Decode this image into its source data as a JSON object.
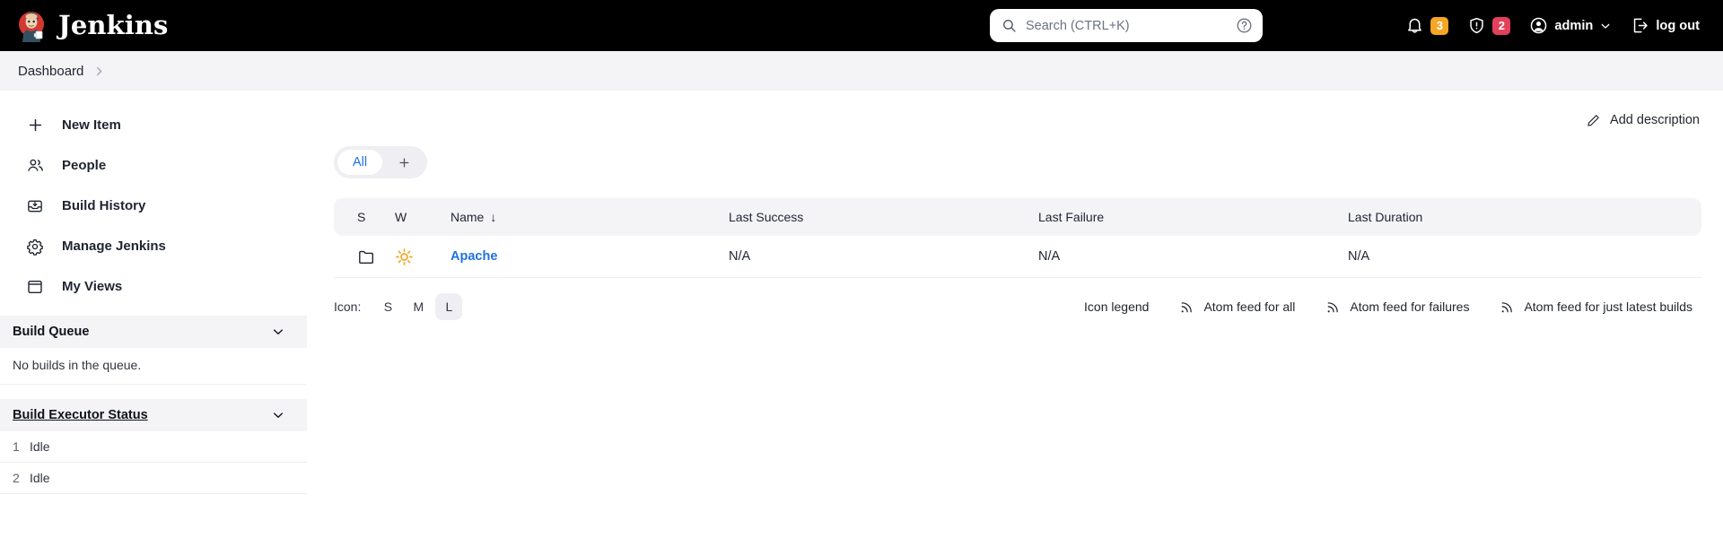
{
  "header": {
    "brand_title": "Jenkins",
    "logo_icon": "jenkins-butler-logo",
    "search": {
      "icon": "search-icon",
      "placeholder": "Search (CTRL+K)",
      "value": "",
      "help_icon": "question-circle-icon"
    },
    "notifications": {
      "icon": "bell-icon",
      "count": "3",
      "color": "#f5a623"
    },
    "security": {
      "icon": "shield-warning-icon",
      "count": "2",
      "color": "#e2405b"
    },
    "user": {
      "icon": "user-circle-icon",
      "name": "admin",
      "chevron_icon": "chevron-down-icon"
    },
    "logout": {
      "icon": "logout-icon",
      "label": "log out"
    }
  },
  "breadcrumb": {
    "items": [
      {
        "label": "Dashboard"
      }
    ],
    "separator_icon": "chevron-right-icon"
  },
  "sidebar": {
    "nav": [
      {
        "label": "New Item",
        "icon": "plus-icon"
      },
      {
        "label": "People",
        "icon": "people-icon"
      },
      {
        "label": "Build History",
        "icon": "build-history-icon"
      },
      {
        "label": "Manage Jenkins",
        "icon": "gear-icon"
      },
      {
        "label": "My Views",
        "icon": "window-icon"
      }
    ],
    "build_queue": {
      "title": "Build Queue",
      "collapse_icon": "chevron-down-icon",
      "empty_text": "No builds in the queue."
    },
    "build_executor_status": {
      "title": "Build Executor Status",
      "collapse_icon": "chevron-down-icon",
      "executors": [
        {
          "number": "1",
          "status": "Idle"
        },
        {
          "number": "2",
          "status": "Idle"
        }
      ]
    }
  },
  "main": {
    "add_description": {
      "label": "Add description",
      "icon": "pencil-icon"
    },
    "view_tabs": {
      "tabs": [
        {
          "label": "All",
          "active": true
        }
      ],
      "add_tab": {
        "label": "+",
        "icon": "plus-icon"
      }
    },
    "jobs_table": {
      "columns": [
        {
          "key": "s",
          "label": "S"
        },
        {
          "key": "w",
          "label": "W"
        },
        {
          "key": "name",
          "label": "Name",
          "sorted": true,
          "sort_mark": "↓"
        },
        {
          "key": "last_success",
          "label": "Last Success"
        },
        {
          "key": "last_failure",
          "label": "Last Failure"
        },
        {
          "key": "last_duration",
          "label": "Last Duration"
        }
      ],
      "rows": [
        {
          "status_icon": "folder-icon",
          "weather_icon": "sunny-icon",
          "weather_color": "#f5a623",
          "name": "Apache",
          "last_success": "N/A",
          "last_failure": "N/A",
          "last_duration": "N/A"
        }
      ]
    },
    "footer": {
      "icon_label": "Icon:",
      "icon_sizes": [
        {
          "label": "S",
          "active": false
        },
        {
          "label": "M",
          "active": false
        },
        {
          "label": "L",
          "active": true
        }
      ],
      "links": [
        {
          "label": "Icon legend",
          "icon": null
        },
        {
          "label": "Atom feed for all",
          "icon": "rss-icon"
        },
        {
          "label": "Atom feed for failures",
          "icon": "rss-icon"
        },
        {
          "label": "Atom feed for just latest builds",
          "icon": "rss-icon"
        }
      ]
    }
  }
}
